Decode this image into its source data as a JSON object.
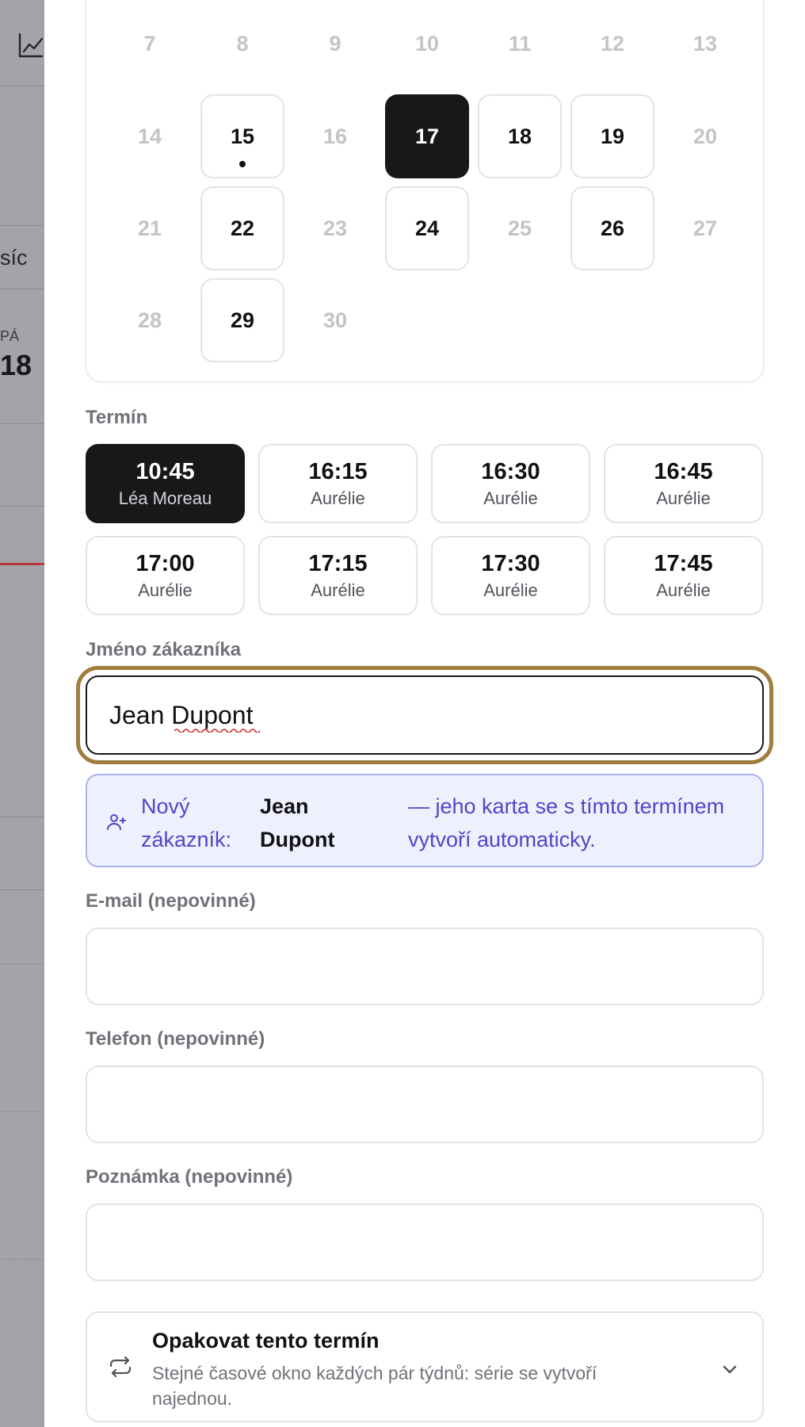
{
  "background": {
    "tab_label_fragment": "síc",
    "stat_label_fragment": "PÁ",
    "stat_value_fragment": "18",
    "trend_icon": "chart-line-icon"
  },
  "calendar": {
    "days": [
      {
        "label": "7",
        "state": "muted"
      },
      {
        "label": "8",
        "state": "muted"
      },
      {
        "label": "9",
        "state": "muted"
      },
      {
        "label": "10",
        "state": "muted"
      },
      {
        "label": "11",
        "state": "muted"
      },
      {
        "label": "12",
        "state": "muted"
      },
      {
        "label": "13",
        "state": "muted"
      },
      {
        "label": "14",
        "state": "muted"
      },
      {
        "label": "15",
        "state": "available",
        "has_event": true
      },
      {
        "label": "16",
        "state": "muted"
      },
      {
        "label": "17",
        "state": "selected"
      },
      {
        "label": "18",
        "state": "available"
      },
      {
        "label": "19",
        "state": "available"
      },
      {
        "label": "20",
        "state": "muted"
      },
      {
        "label": "21",
        "state": "muted"
      },
      {
        "label": "22",
        "state": "available"
      },
      {
        "label": "23",
        "state": "muted"
      },
      {
        "label": "24",
        "state": "available"
      },
      {
        "label": "25",
        "state": "muted"
      },
      {
        "label": "26",
        "state": "available"
      },
      {
        "label": "27",
        "state": "muted"
      },
      {
        "label": "28",
        "state": "muted"
      },
      {
        "label": "29",
        "state": "available"
      },
      {
        "label": "30",
        "state": "muted"
      }
    ]
  },
  "slots_label": "Termín",
  "slots": [
    {
      "time": "10:45",
      "name": "Léa Moreau",
      "selected": true
    },
    {
      "time": "16:15",
      "name": "Aurélie",
      "selected": false
    },
    {
      "time": "16:30",
      "name": "Aurélie",
      "selected": false
    },
    {
      "time": "16:45",
      "name": "Aurélie",
      "selected": false
    },
    {
      "time": "17:00",
      "name": "Aurélie",
      "selected": false
    },
    {
      "time": "17:15",
      "name": "Aurélie",
      "selected": false
    },
    {
      "time": "17:30",
      "name": "Aurélie",
      "selected": false
    },
    {
      "time": "17:45",
      "name": "Aurélie",
      "selected": false
    }
  ],
  "customer": {
    "label": "Jméno zákazníka",
    "value": "Jean Dupont"
  },
  "notice": {
    "prefix": "Nový zákazník:",
    "name": "Jean Dupont",
    "suffix": "— jeho karta se s tímto termínem vytvoří automaticky.",
    "icon": "user-plus-icon"
  },
  "email": {
    "label": "E-mail (nepovinné)",
    "value": ""
  },
  "phone": {
    "label": "Telefon (nepovinné)",
    "value": ""
  },
  "note": {
    "label": "Poznámka (nepovinné)",
    "value": ""
  },
  "repeat": {
    "title": "Opakovat tento termín",
    "description": "Stejné časové okno každých pár týdnů: série se vytvoří najednou.",
    "icon": "repeat-icon"
  },
  "colors": {
    "selected": "#18181b",
    "focus_ring": "#a07d3c",
    "notice_bg": "#eef0fd",
    "notice_text": "#4f46c8"
  }
}
